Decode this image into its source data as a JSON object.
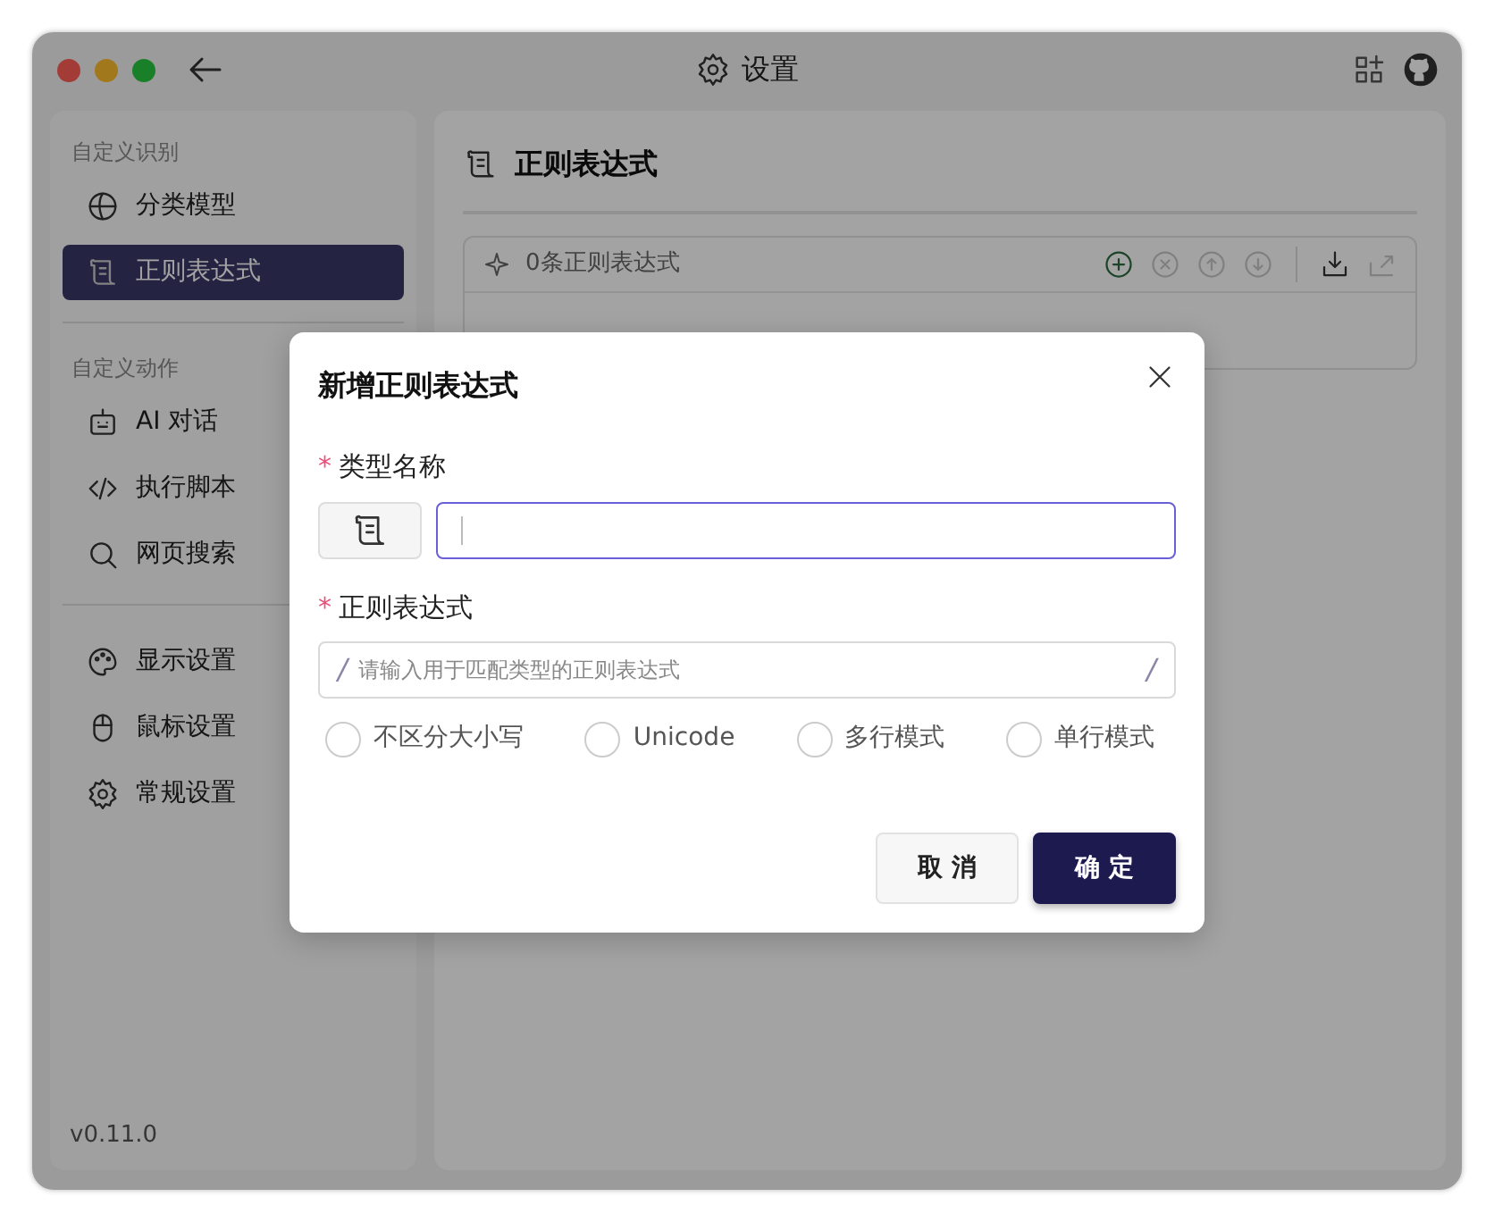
{
  "window": {
    "title": "设置"
  },
  "sidebar": {
    "sections": [
      {
        "label": "自定义识别",
        "items": [
          {
            "label": "分类模型",
            "kind": "globe",
            "selected": false
          },
          {
            "label": "正则表达式",
            "kind": "scroll",
            "selected": true
          }
        ]
      },
      {
        "label": "自定义动作",
        "items": [
          {
            "label": "AI 对话",
            "kind": "bot",
            "selected": false
          },
          {
            "label": "执行脚本",
            "kind": "code",
            "selected": false
          },
          {
            "label": "网页搜索",
            "kind": "search",
            "selected": false
          }
        ]
      },
      {
        "items": [
          {
            "label": "显示设置",
            "kind": "palette",
            "selected": false
          },
          {
            "label": "鼠标设置",
            "kind": "mouse",
            "selected": false
          },
          {
            "label": "常规设置",
            "kind": "gear",
            "selected": false
          }
        ]
      }
    ],
    "version": "v0.11.0"
  },
  "main": {
    "title": "正则表达式",
    "list": {
      "count": "0条正则表达式",
      "toolbar": [
        {
          "kind": "add",
          "disabled": false
        },
        {
          "kind": "remove",
          "disabled": true
        },
        {
          "kind": "up",
          "disabled": true
        },
        {
          "kind": "down",
          "disabled": true
        },
        {
          "kind": "import",
          "disabled": false
        },
        {
          "kind": "export",
          "disabled": true
        }
      ]
    }
  },
  "dialog": {
    "title": "新增正则表达式",
    "fields": [
      {
        "mark": "*",
        "label": "类型名称",
        "focused": true
      },
      {
        "mark": "*",
        "label": "正则表达式",
        "prefix": "/",
        "suffix": "/",
        "placeholder": "请输入用于匹配类型的正则表达式",
        "focused": false
      }
    ],
    "flags": [
      {
        "label": "不区分大小写",
        "checked": false
      },
      {
        "label": "Unicode",
        "checked": false
      },
      {
        "label": "多行模式",
        "checked": false
      },
      {
        "label": "单行模式",
        "checked": false
      }
    ],
    "buttons": [
      {
        "label": "取 消",
        "kind": "secondary"
      },
      {
        "label": "确 定",
        "kind": "primary"
      }
    ]
  }
}
